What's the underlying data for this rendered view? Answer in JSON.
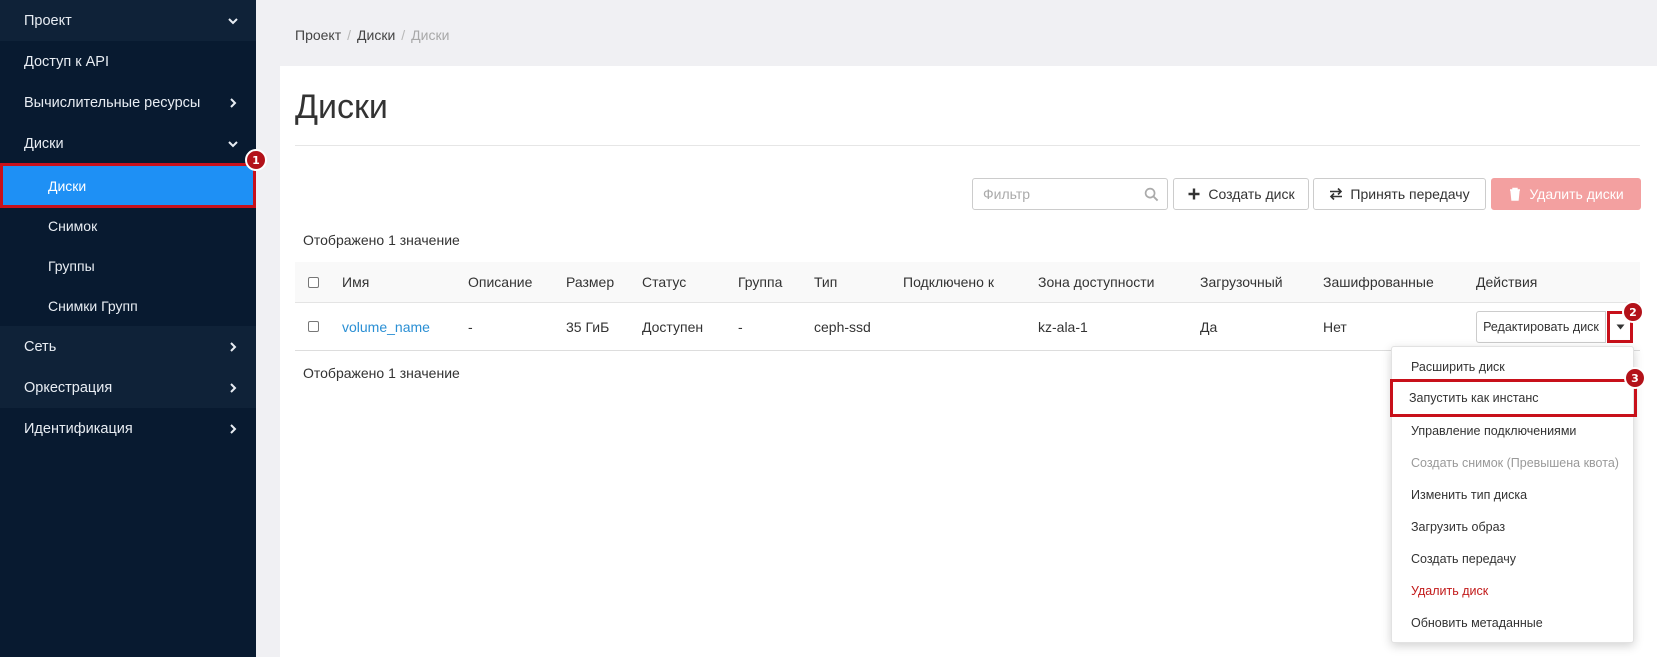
{
  "sidebar": {
    "project": "Проект",
    "api_access": "Доступ к API",
    "compute": "Вычислительные ресурсы",
    "volumes_section": "Диски",
    "volumes": "Диски",
    "snapshots": "Снимок",
    "groups": "Группы",
    "group_snapshots": "Снимки Групп",
    "network": "Сеть",
    "orchestration": "Оркестрация",
    "identity": "Идентификация"
  },
  "badges": {
    "b1": "1",
    "b2": "2",
    "b3": "3"
  },
  "breadcrumb": {
    "project": "Проект",
    "sep": "/",
    "volumes": "Диски",
    "current": "Диски"
  },
  "page_title": "Диски",
  "toolbar": {
    "filter_placeholder": "Фильтр",
    "create": "Создать диск",
    "accept_transfer": "Принять передачу",
    "delete": "Удалить диски"
  },
  "count_text": "Отображено 1 значение",
  "table": {
    "headers": [
      "Имя",
      "Описание",
      "Размер",
      "Статус",
      "Группа",
      "Тип",
      "Подключено к",
      "Зона доступности",
      "Загрузочный",
      "Зашифрованные",
      "Действия"
    ],
    "row": {
      "name": "volume_name",
      "description": "-",
      "size": "35 ГиБ",
      "status": "Доступен",
      "group": "-",
      "type": "ceph-ssd",
      "attached": "",
      "zone": "kz-ala-1",
      "bootable": "Да",
      "encrypted": "Нет",
      "action": "Редактировать диск"
    }
  },
  "dropdown": {
    "extend": "Расширить диск",
    "launch": "Запустить как инстанс",
    "manage_attachments": "Управление подключениями",
    "create_snapshot": "Создать снимок (Превышена квота)",
    "change_type": "Изменить тип диска",
    "upload_image": "Загрузить образ",
    "create_transfer": "Создать передачу",
    "delete": "Удалить диск",
    "update_metadata": "Обновить метаданные"
  },
  "colors": {
    "sidebar_bg": "#081a30",
    "active_item": "#1e90f5",
    "highlight_red": "#c8101a",
    "link": "#2a8fd4",
    "delete_button": "#f3a0a0"
  }
}
